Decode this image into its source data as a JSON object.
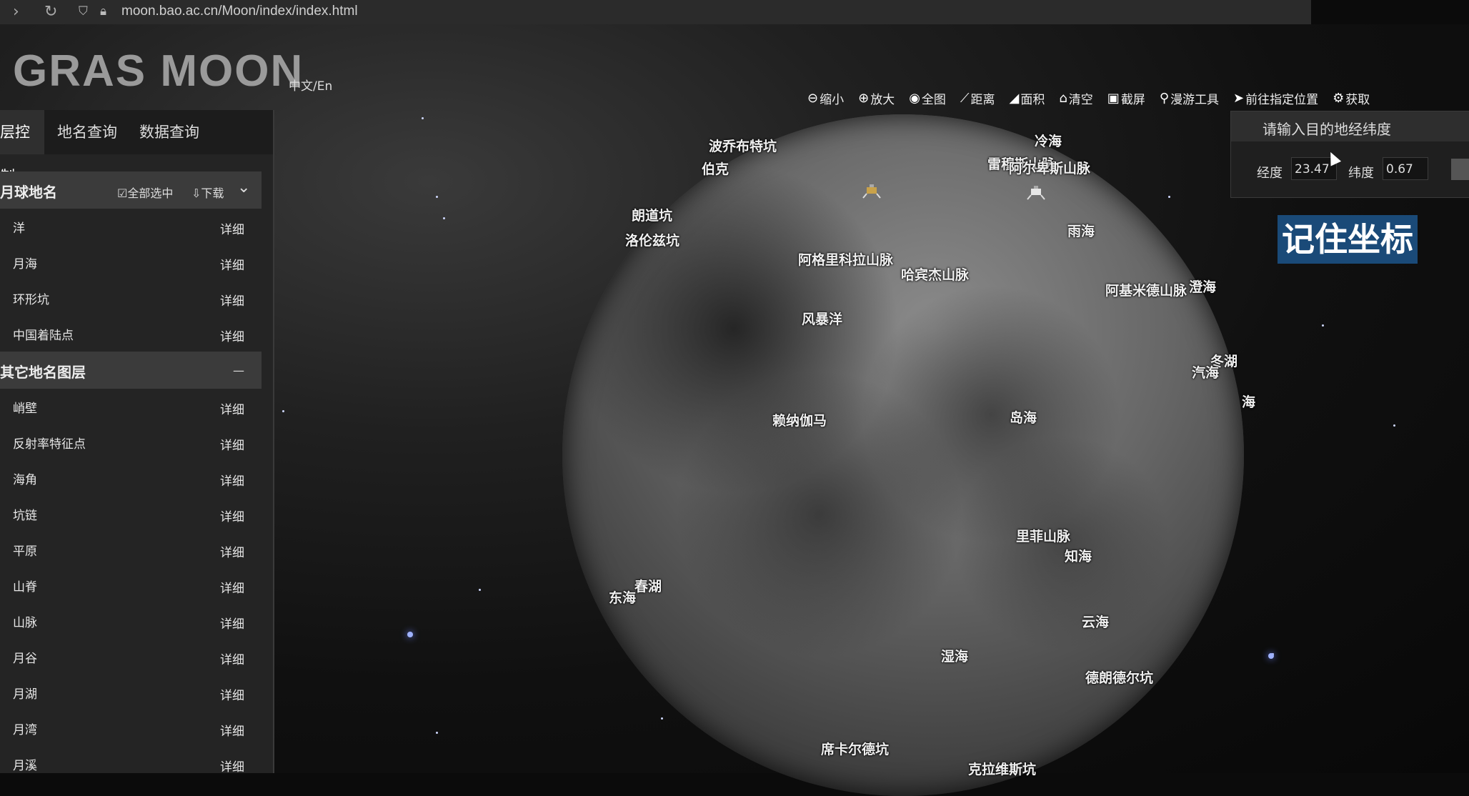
{
  "browser": {
    "url": "moon.bao.ac.cn/Moon/index/index.html"
  },
  "header": {
    "logo": "GRAS MOON",
    "lang": "中文/En",
    "tools": [
      {
        "icon": "zoom-out-icon",
        "glyph": "⊖",
        "label": "缩小"
      },
      {
        "icon": "zoom-in-icon",
        "glyph": "⊕",
        "label": "放大"
      },
      {
        "icon": "globe-icon",
        "glyph": "◉",
        "label": "全图"
      },
      {
        "icon": "ruler-icon",
        "glyph": "⟋",
        "label": "距离"
      },
      {
        "icon": "area-icon",
        "glyph": "◢",
        "label": "面积"
      },
      {
        "icon": "eraser-icon",
        "glyph": "⌂",
        "label": "清空"
      },
      {
        "icon": "camera-icon",
        "glyph": "▣",
        "label": "截屏"
      },
      {
        "icon": "pin-icon",
        "glyph": "⚲",
        "label": "漫游工具"
      },
      {
        "icon": "send-icon",
        "glyph": "➤",
        "label": "前往指定位置"
      },
      {
        "icon": "gear-icon",
        "glyph": "⚙",
        "label": "获取"
      }
    ]
  },
  "sidebar": {
    "tabs": [
      "层控制",
      "地名查询",
      "数据查询"
    ],
    "section1": {
      "title": "月球地名",
      "select_all": "☑全部选中",
      "download": "⇩下载",
      "items": [
        "洋",
        "月海",
        "环形坑",
        "中国着陆点"
      ]
    },
    "section2": {
      "title": "其它地名图层",
      "collapse": "—",
      "items": [
        "峭壁",
        "反射率特征点",
        "海角",
        "坑链",
        "平原",
        "山脊",
        "山脉",
        "月谷",
        "月湖",
        "月湾",
        "月溪"
      ]
    },
    "detail_label": "详细"
  },
  "moon_labels": [
    "冷海",
    "波乔布特坑",
    "伯克",
    "雷穆斯山脉",
    "阿尔卑斯山脉",
    "朗道坑",
    "洛伦兹坑",
    "雨海",
    "阿格里科拉山脉",
    "哈宾杰山脉",
    "阿基米德山脉",
    "澄海",
    "风暴洋",
    "冬湖",
    "汽海",
    "海",
    "赖纳伽马",
    "岛海",
    "里菲山脉",
    "知海",
    "春湖",
    "东海",
    "云海",
    "湿海",
    "德朗德尔坑",
    "席卡尔德坑",
    "克拉维斯坑"
  ],
  "coord_panel": {
    "title": "请输入目的地经纬度",
    "lon_label": "经度",
    "lon_value": "23.47",
    "lat_label": "纬度",
    "lat_value": "0.67"
  },
  "remember_button": "记住坐标"
}
